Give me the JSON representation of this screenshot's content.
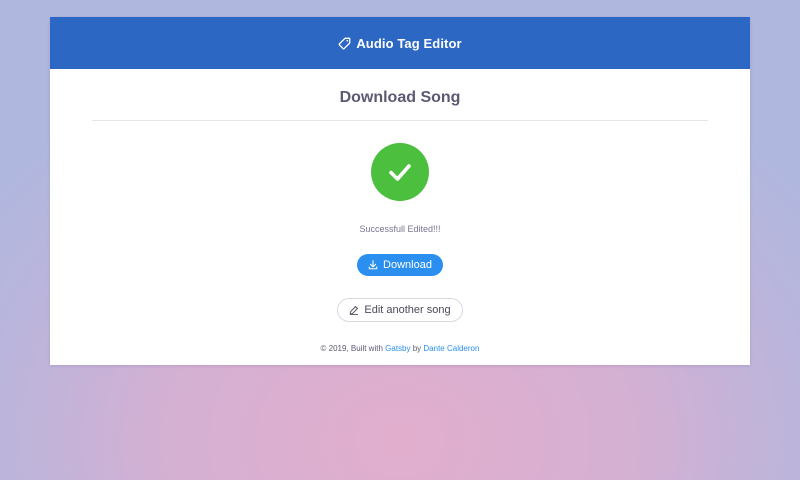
{
  "header": {
    "title": "Audio Tag Editor",
    "icon": "tag-icon"
  },
  "page": {
    "title": "Download Song",
    "status_icon": "check-icon",
    "status_color": "#4cbf3e",
    "status_text": "Successfull Edited!!!"
  },
  "actions": {
    "download_label": "Download",
    "download_icon": "download-icon",
    "download_color": "#2b8ff0",
    "edit_label": "Edit another song",
    "edit_icon": "pencil-icon"
  },
  "footer": {
    "prefix": "© 2019, Built with",
    "framework_link": "Gatsby",
    "by": "by",
    "author_link": "Dante Calderon"
  },
  "colors": {
    "header_bg": "#2c67c4",
    "link": "#2b8ff0"
  }
}
